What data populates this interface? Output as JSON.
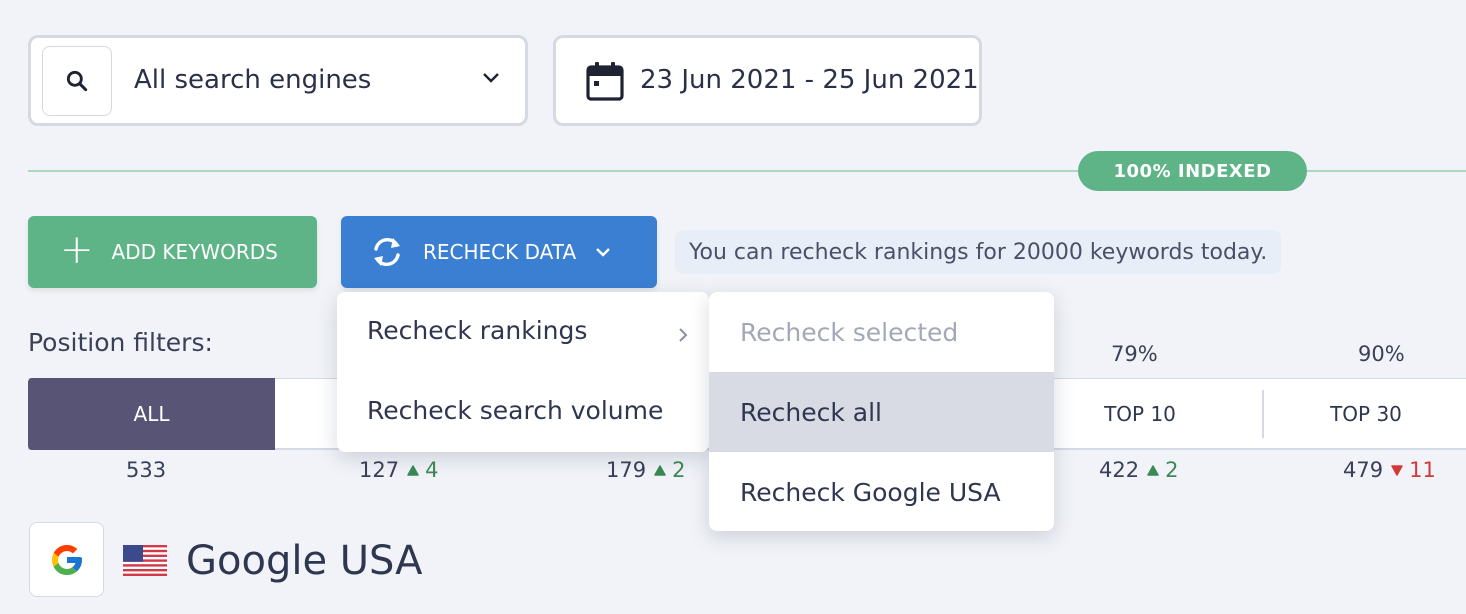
{
  "engine_select": {
    "value": "All search engines"
  },
  "date_range": {
    "value": "23 Jun 2021 - 25 Jun 2021"
  },
  "indexed_badge": "100% INDEXED",
  "actions": {
    "add_keywords": "ADD KEYWORDS",
    "recheck_data": "RECHECK DATA",
    "note": "You can recheck rankings for 20000 keywords today."
  },
  "recheck_menu": {
    "items": [
      {
        "label": "Recheck rankings"
      },
      {
        "label": "Recheck search volume"
      }
    ]
  },
  "rankings_submenu": {
    "items": [
      {
        "label": "Recheck selected",
        "state": "disabled"
      },
      {
        "label": "Recheck all",
        "state": "hovered"
      },
      {
        "label": "Recheck Google USA",
        "state": "normal"
      }
    ]
  },
  "position_filters": {
    "label": "Position filters:",
    "tabs": [
      {
        "label": "ALL",
        "percent": "",
        "count": "533",
        "change": "",
        "direction": ""
      },
      {
        "label": "",
        "percent": "",
        "count": "127",
        "change": "4",
        "direction": "up"
      },
      {
        "label": "",
        "percent": "",
        "count": "179",
        "change": "2",
        "direction": "up"
      },
      {
        "label": "TOP 10",
        "percent": "79%",
        "count": "422",
        "change": "2",
        "direction": "up"
      },
      {
        "label": "TOP 30",
        "percent": "90%",
        "count": "479",
        "change": "11",
        "direction": "down"
      }
    ]
  },
  "search_engine": {
    "name": "Google USA"
  },
  "colors": {
    "green": "#5fb487",
    "blue": "#3b7fd3",
    "purple": "#575475",
    "up": "#3a8a55",
    "down": "#d23a3a"
  }
}
